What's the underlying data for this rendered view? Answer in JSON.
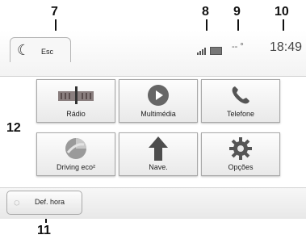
{
  "callouts": {
    "c7": "7",
    "c8": "8",
    "c9": "9",
    "c10": "10",
    "c11": "11",
    "c12": "12"
  },
  "header": {
    "esc_label": "Esc",
    "moon_icon": "moon-icon",
    "temperature": "-- °",
    "time": "18:49"
  },
  "tiles": [
    {
      "label": "Rádio",
      "icon": "radio-icon"
    },
    {
      "label": "Multimédia",
      "icon": "play-icon"
    },
    {
      "label": "Telefone",
      "icon": "phone-icon"
    },
    {
      "label": "Driving eco²",
      "icon": "driving-eco-icon"
    },
    {
      "label": "Nave.",
      "icon": "navigation-arrow-icon"
    },
    {
      "label": "Opções",
      "icon": "gear-icon"
    }
  ],
  "footer": {
    "def_hora_label": "Def. hora",
    "icon": "clock-icon"
  }
}
